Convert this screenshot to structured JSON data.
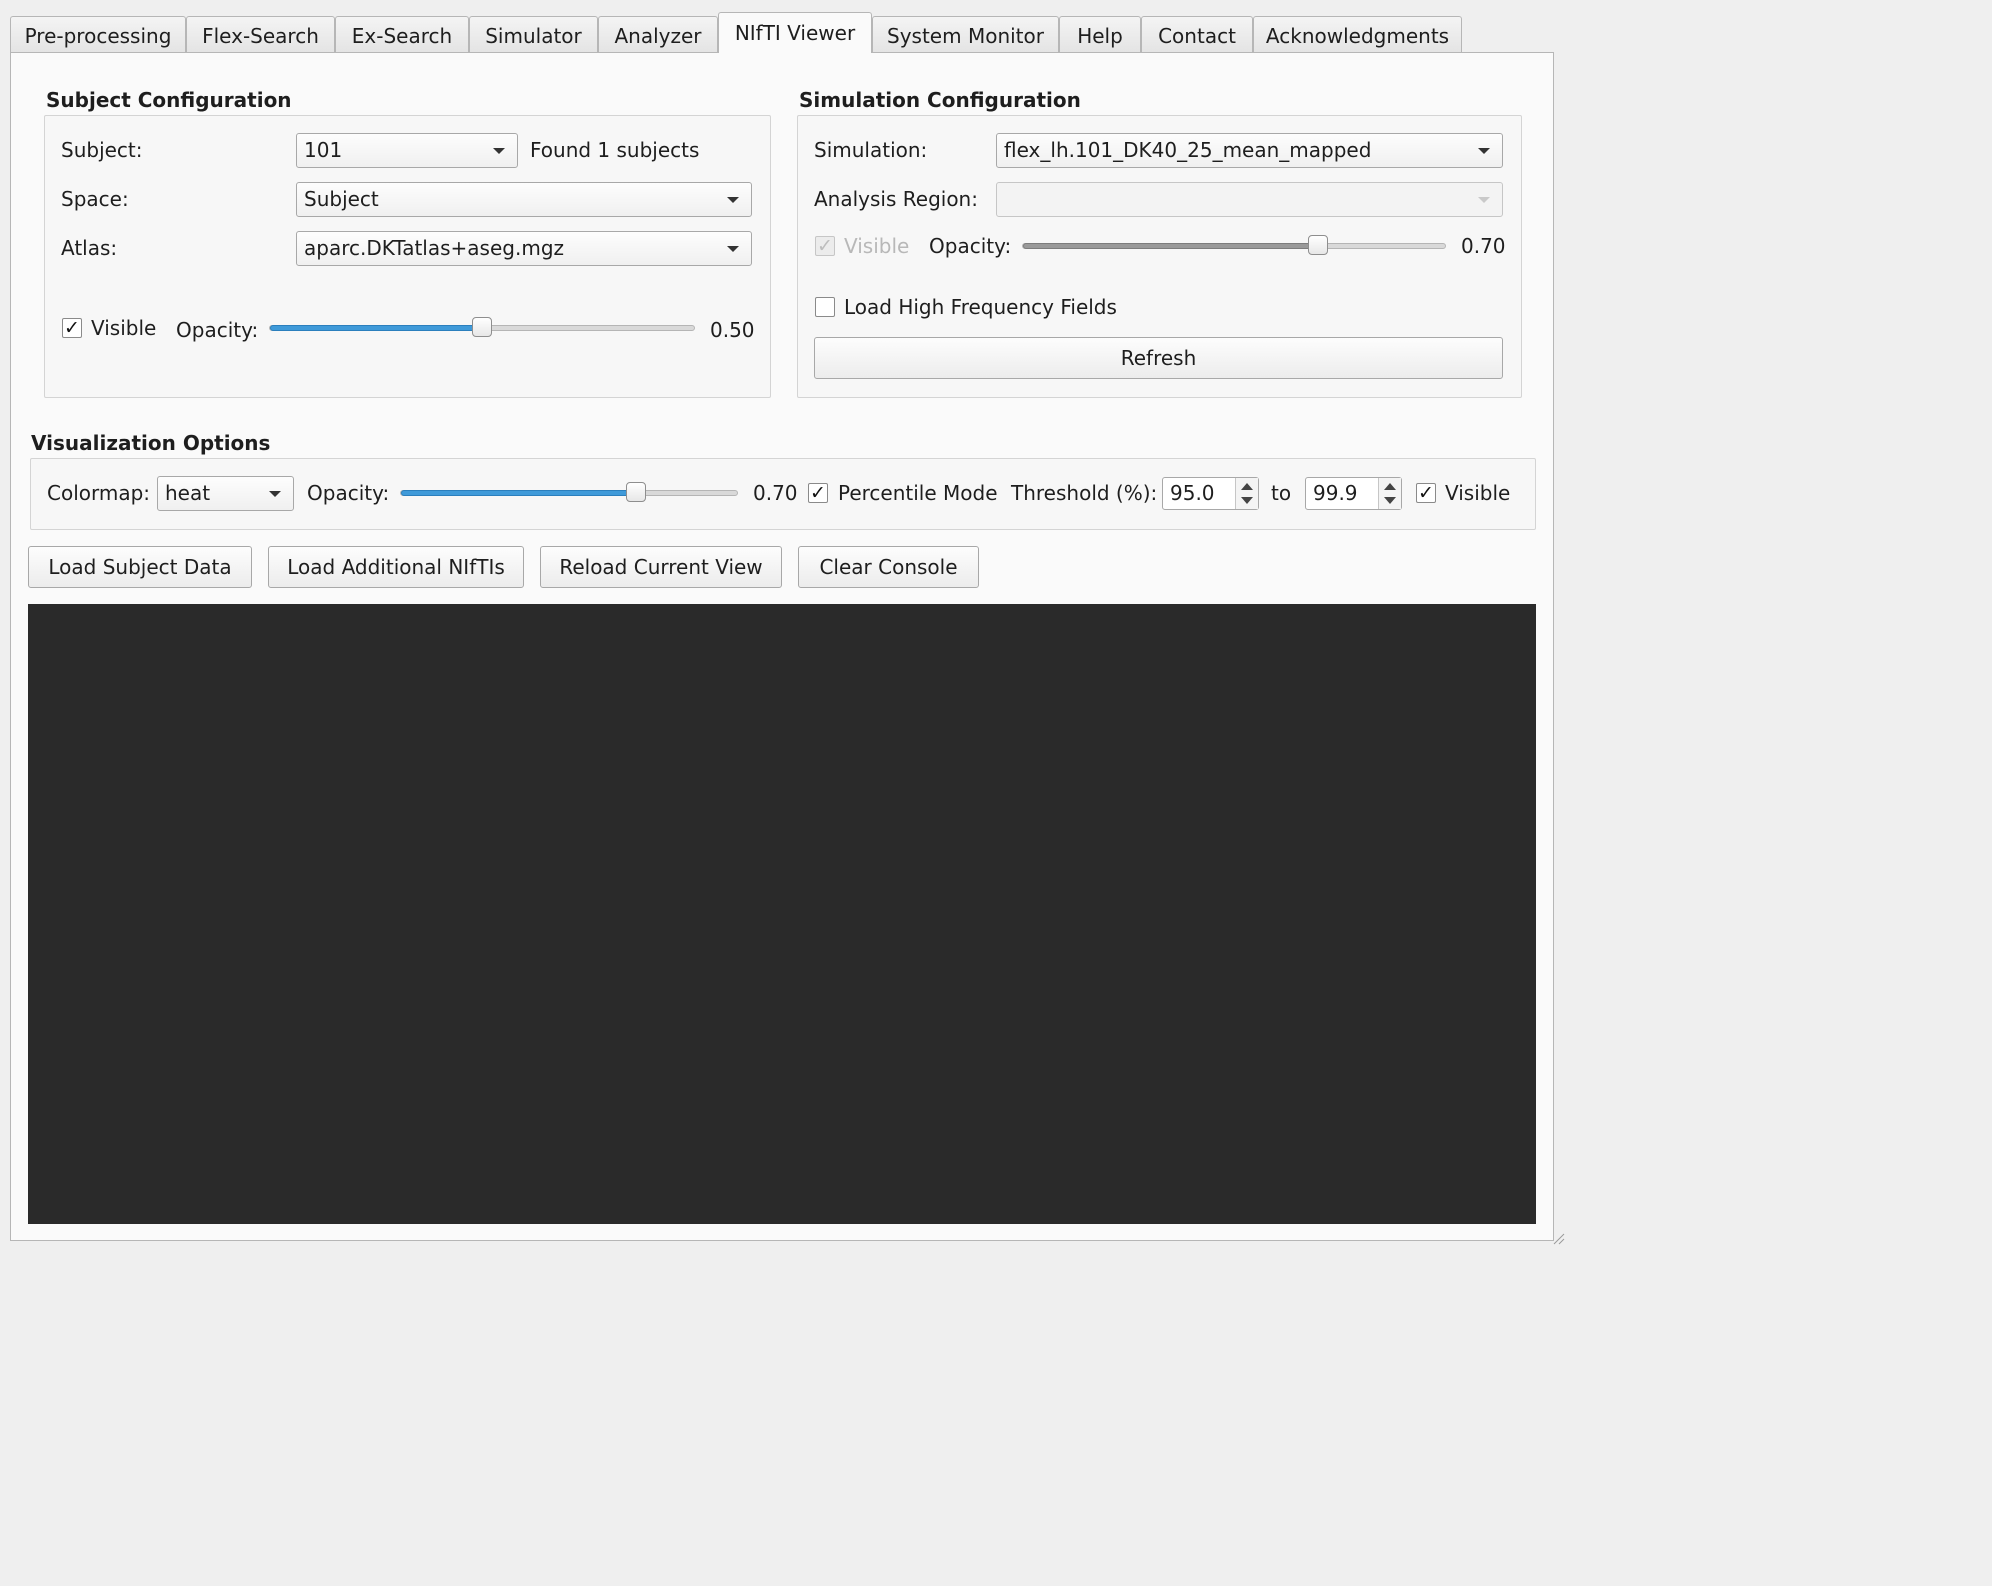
{
  "tabs": [
    {
      "label": "Pre-processing"
    },
    {
      "label": "Flex-Search"
    },
    {
      "label": "Ex-Search"
    },
    {
      "label": "Simulator"
    },
    {
      "label": "Analyzer"
    },
    {
      "label": "NIfTI Viewer",
      "active": true
    },
    {
      "label": "System Monitor"
    },
    {
      "label": "Help"
    },
    {
      "label": "Contact"
    },
    {
      "label": "Acknowledgments"
    }
  ],
  "subject_config": {
    "title": "Subject Configuration",
    "subject_label": "Subject:",
    "subject_value": "101",
    "found_text": "Found 1 subjects",
    "space_label": "Space:",
    "space_value": "Subject",
    "atlas_label": "Atlas:",
    "atlas_value": "aparc.DKTatlas+aseg.mgz",
    "visible_label": "Visible",
    "visible_checked": true,
    "opacity_label": "Opacity:",
    "opacity_value": "0.50",
    "opacity_fraction": 0.5
  },
  "simulation_config": {
    "title": "Simulation Configuration",
    "simulation_label": "Simulation:",
    "simulation_value": "flex_lh.101_DK40_25_mean_mapped",
    "region_label": "Analysis Region:",
    "region_value": "",
    "visible_label": "Visible",
    "visible_checked": true,
    "opacity_label": "Opacity:",
    "opacity_value": "0.70",
    "opacity_fraction": 0.7,
    "high_freq_label": "Load High Frequency Fields",
    "high_freq_checked": false,
    "refresh_label": "Refresh"
  },
  "visualization": {
    "title": "Visualization Options",
    "colormap_label": "Colormap:",
    "colormap_value": "heat",
    "opacity_label": "Opacity:",
    "opacity_value": "0.70",
    "opacity_fraction": 0.7,
    "percentile_label": "Percentile Mode",
    "percentile_checked": true,
    "threshold_label": "Threshold (%):",
    "threshold_min": "95.0",
    "to_label": "to",
    "threshold_max": "99.9",
    "visible_label": "Visible",
    "visible_checked": true
  },
  "actions": {
    "load_subject": "Load Subject Data",
    "load_additional": "Load Additional NIfTIs",
    "reload_view": "Reload Current View",
    "clear_console": "Clear Console"
  },
  "colors": {
    "accent": "#3f9ad9",
    "viewer_bg": "#2a2a2a",
    "pane_bg": "#fafafa"
  }
}
